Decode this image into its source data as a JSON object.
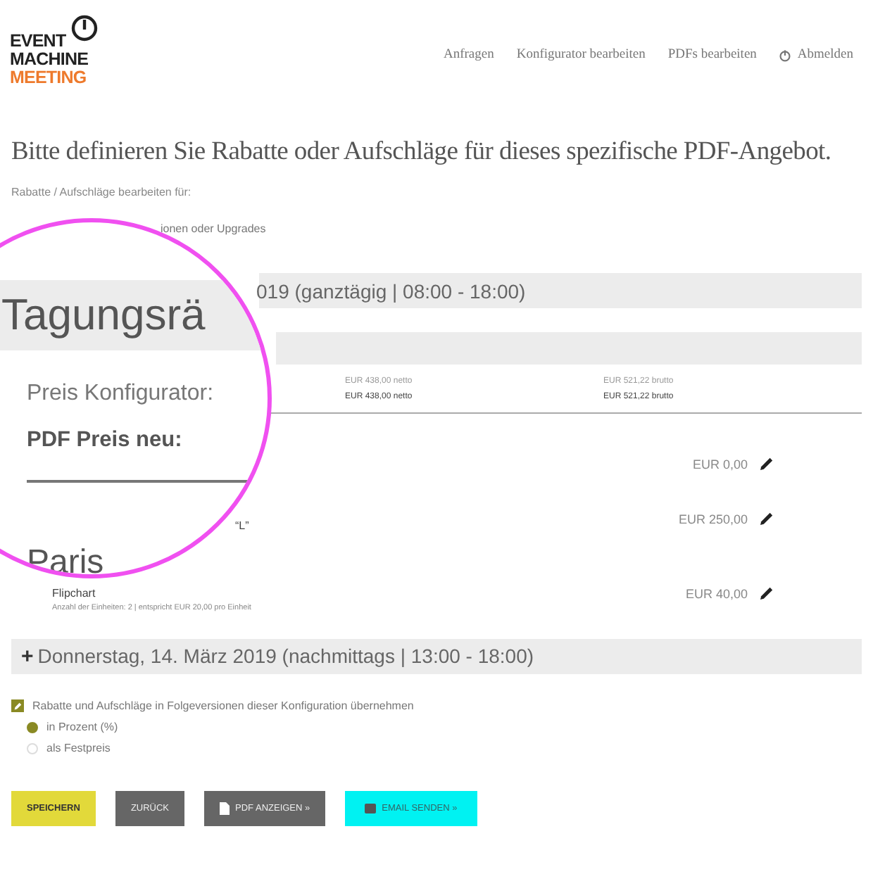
{
  "header": {
    "logo": [
      "EVENT",
      "MACHINE",
      "MEETING"
    ],
    "nav": [
      "Anfragen",
      "Konfigurator bearbeiten",
      "PDFs bearbeiten",
      "Abmelden"
    ]
  },
  "heading": "Bitte definieren Sie Rabatte oder Aufschläge für dieses spezifische PDF-Angebot.",
  "intro": "Rabatte / Aufschläge bearbeiten für:",
  "subtitle_fragment": "ionen oder Upgrades",
  "magnifier": {
    "day_title": "Tagungsrä",
    "price_label": "Preis Konfigurator:",
    "pdf_price_label": "PDF Preis neu:",
    "room": "Paris"
  },
  "day_1_header": "019 (ganztägig | 08:00 - 18:00)",
  "prices": {
    "net": [
      "EUR 438,00 netto",
      "EUR 438,00 netto"
    ],
    "gross": [
      "EUR 521,22 brutto",
      "EUR 521,22 brutto"
    ]
  },
  "items": [
    {
      "price": "EUR 0,00"
    },
    {
      "name": "“L”",
      "price": "EUR 250,00"
    },
    {
      "name": "Flipchart",
      "detail": "Anzahl der Einheiten: 2 | entspricht EUR 20,00 pro Einheit",
      "price": "EUR 40,00"
    }
  ],
  "day_2_header": {
    "symbol": "+",
    "title": "Donnerstag, 14. März 2019 (nachmittags | 13:00 - 18:00)"
  },
  "carry_over": {
    "label": "Rabatte und Aufschläge in Folgeversionen dieser Konfiguration übernehmen",
    "checked": true
  },
  "mode_options": [
    {
      "label": "in Prozent (%)",
      "selected": true
    },
    {
      "label": "als Festpreis",
      "selected": false
    }
  ],
  "buttons": [
    {
      "label": "SPEICHERN",
      "kind": "save"
    },
    {
      "label": "ZURÜCK",
      "kind": "back"
    },
    {
      "label": "PDF ANZEIGEN »",
      "kind": "pdf"
    },
    {
      "label": "EMAIL SENDEN »",
      "kind": "email"
    }
  ]
}
